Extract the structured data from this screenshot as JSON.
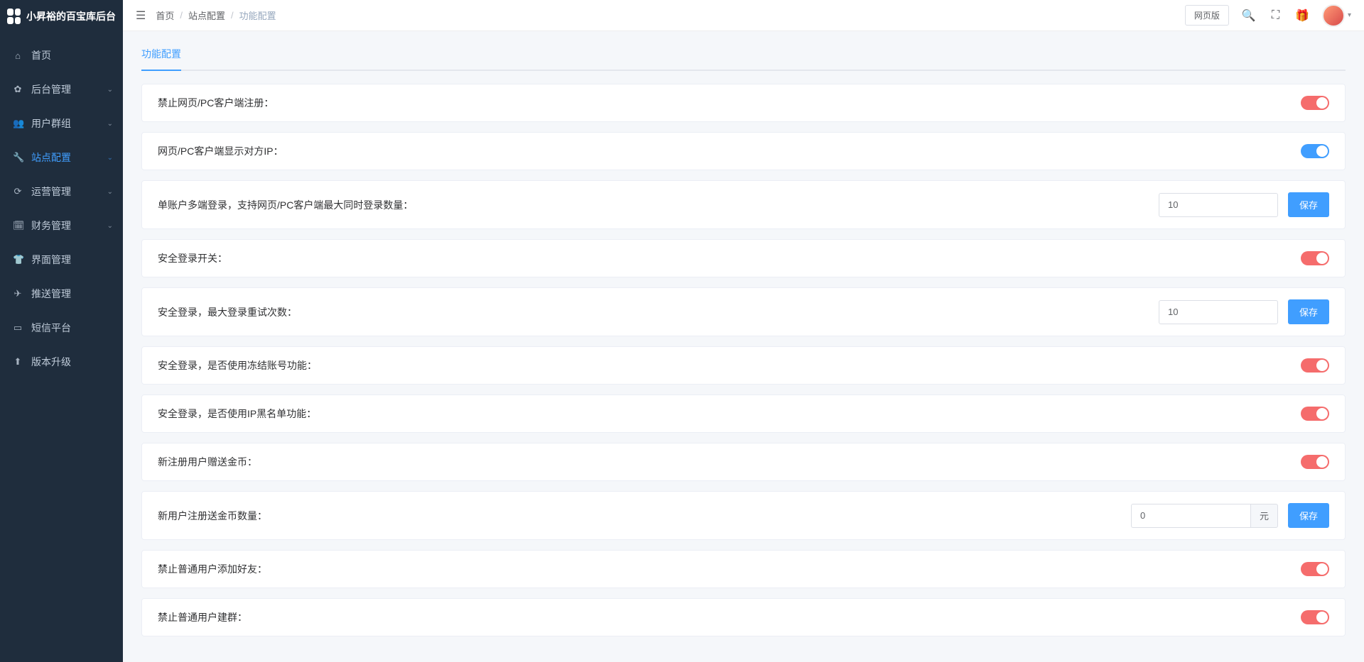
{
  "app": {
    "title": "小昇裕的百宝库后台"
  },
  "sidebar": {
    "items": [
      {
        "icon": "⌂",
        "label": "首页",
        "expandable": false
      },
      {
        "icon": "✿",
        "label": "后台管理",
        "expandable": true
      },
      {
        "icon": "👥",
        "label": "用户群组",
        "expandable": true
      },
      {
        "icon": "🔧",
        "label": "站点配置",
        "expandable": true,
        "active": true
      },
      {
        "icon": "⟳",
        "label": "运营管理",
        "expandable": true
      },
      {
        "icon": "🗓",
        "label": "财务管理",
        "expandable": true
      },
      {
        "icon": "👕",
        "label": "界面管理",
        "expandable": false
      },
      {
        "icon": "✈",
        "label": "推送管理",
        "expandable": false
      },
      {
        "icon": "▭",
        "label": "短信平台",
        "expandable": false
      },
      {
        "icon": "⬆",
        "label": "版本升级",
        "expandable": false
      }
    ]
  },
  "topbar": {
    "breadcrumb": [
      "首页",
      "站点配置",
      "功能配置"
    ],
    "version_btn": "网页版"
  },
  "tab": {
    "label": "功能配置"
  },
  "rows": [
    {
      "label": "禁止网页/PC客户端注册：",
      "type": "toggle",
      "state": "on"
    },
    {
      "label": "网页/PC客户端显示对方IP：",
      "type": "toggle",
      "state": "blue"
    },
    {
      "label": "单账户多端登录，支持网页/PC客户端最大同时登录数量：",
      "type": "input_save",
      "value": "10",
      "btn": "保存"
    },
    {
      "label": "安全登录开关：",
      "type": "toggle",
      "state": "on"
    },
    {
      "label": "安全登录，最大登录重试次数：",
      "type": "input_save",
      "value": "10",
      "btn": "保存"
    },
    {
      "label": "安全登录，是否使用冻结账号功能：",
      "type": "toggle",
      "state": "on"
    },
    {
      "label": "安全登录，是否使用IP黑名单功能：",
      "type": "toggle",
      "state": "on"
    },
    {
      "label": "新注册用户赠送金币：",
      "type": "toggle",
      "state": "on"
    },
    {
      "label": "新用户注册送金币数量：",
      "type": "input_suffix_save",
      "value": "0",
      "suffix": "元",
      "btn": "保存"
    },
    {
      "label": "禁止普通用户添加好友：",
      "type": "toggle",
      "state": "on"
    },
    {
      "label": "禁止普通用户建群：",
      "type": "toggle",
      "state": "on"
    }
  ]
}
